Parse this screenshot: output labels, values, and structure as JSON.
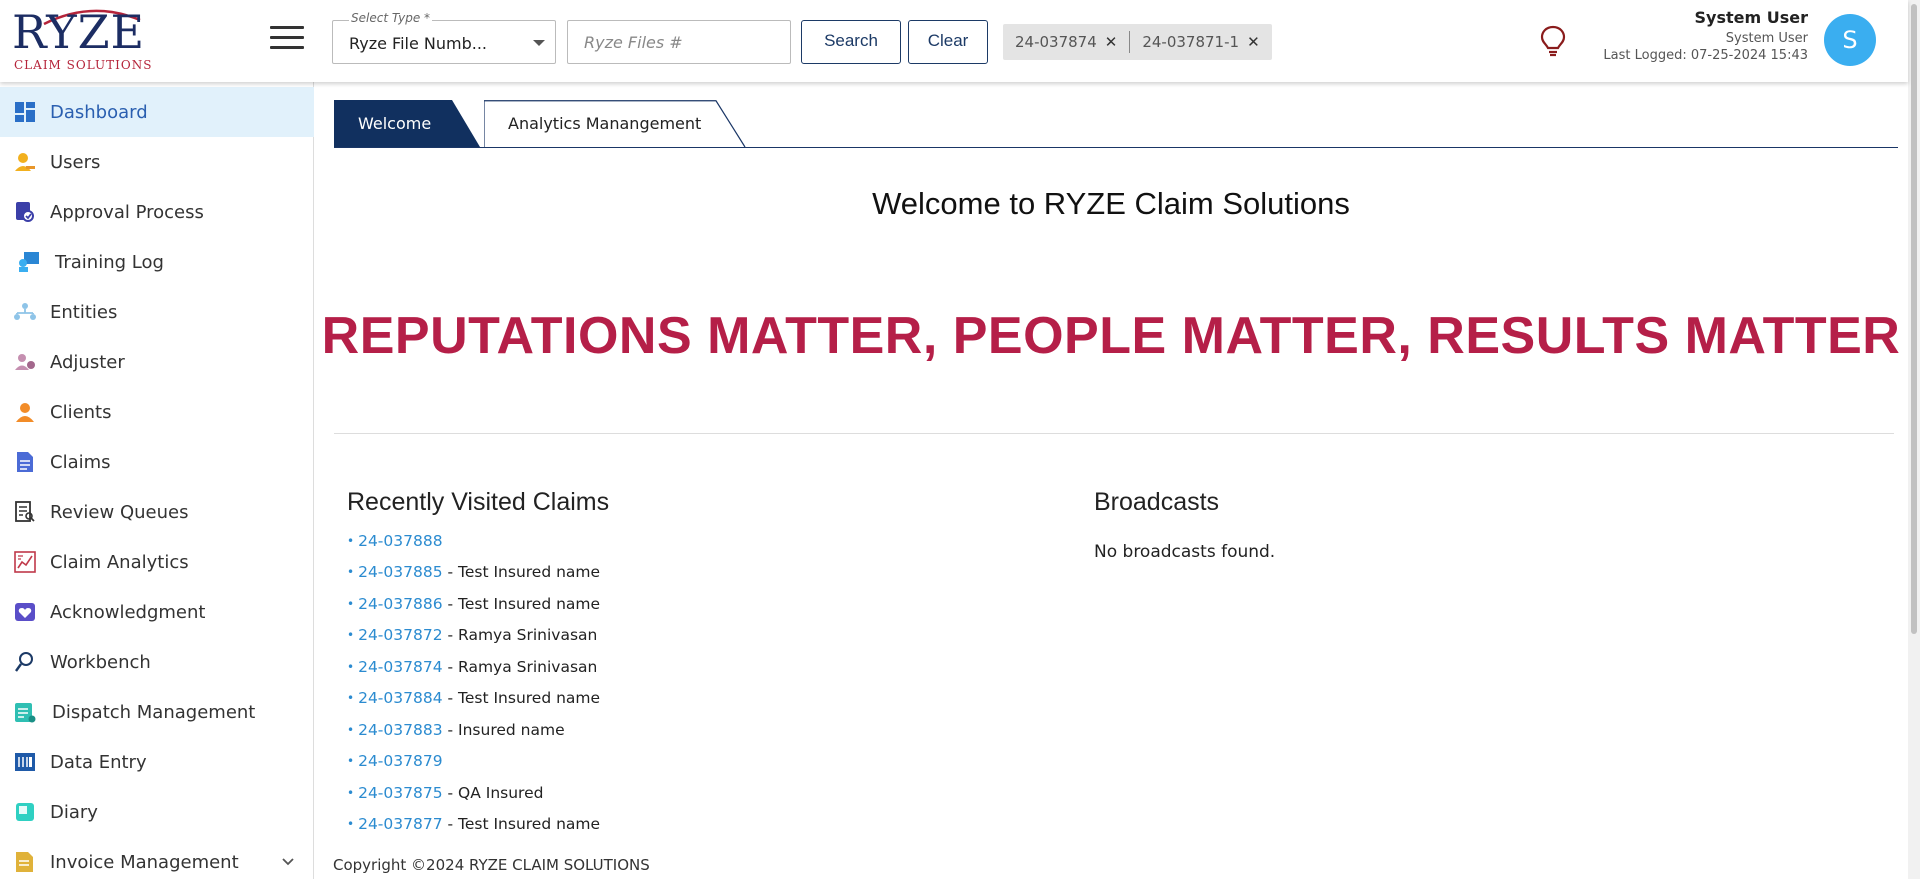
{
  "brand": {
    "logo_main": "RYZE",
    "logo_sub": "CLAIM SOLUTIONS"
  },
  "header": {
    "select_type": {
      "label": "Select Type *",
      "value": "Ryze File Numb..."
    },
    "files_input": {
      "placeholder": "Ryze Files #",
      "value": ""
    },
    "search_label": "Search",
    "clear_label": "Clear",
    "chips": [
      "24-037874",
      "24-037871-1"
    ],
    "user": {
      "name": "System User",
      "role": "System User",
      "last_logged": "Last Logged: 07-25-2024 15:43",
      "initial": "S"
    }
  },
  "sidebar": {
    "items": [
      {
        "label": "Dashboard",
        "icon": "dashboard-icon",
        "active": true
      },
      {
        "label": "Users",
        "icon": "users-icon"
      },
      {
        "label": "Approval Process",
        "icon": "approval-icon"
      },
      {
        "label": "Training Log",
        "icon": "training-icon"
      },
      {
        "label": "Entities",
        "icon": "entities-icon"
      },
      {
        "label": "Adjuster",
        "icon": "adjuster-icon"
      },
      {
        "label": "Clients",
        "icon": "clients-icon"
      },
      {
        "label": "Claims",
        "icon": "claims-icon"
      },
      {
        "label": "Review Queues",
        "icon": "review-icon"
      },
      {
        "label": "Claim Analytics",
        "icon": "analytics-icon"
      },
      {
        "label": "Acknowledgment",
        "icon": "acknowledgment-icon"
      },
      {
        "label": "Workbench",
        "icon": "workbench-icon"
      },
      {
        "label": "Dispatch Management",
        "icon": "dispatch-icon"
      },
      {
        "label": "Data Entry",
        "icon": "data-entry-icon"
      },
      {
        "label": "Diary",
        "icon": "diary-icon"
      },
      {
        "label": "Invoice Management",
        "icon": "invoice-icon"
      }
    ]
  },
  "tabs": [
    "Welcome",
    "Analytics Manangement"
  ],
  "main": {
    "welcome_title": "Welcome to RYZE Claim Solutions",
    "tagline": "REPUTATIONS MATTER, PEOPLE MATTER, RESULTS MATTER",
    "recent_title": "Recently Visited Claims",
    "recent_claims": [
      {
        "claim": "24-037888",
        "name": ""
      },
      {
        "claim": "24-037885",
        "name": "Test Insured name"
      },
      {
        "claim": "24-037886",
        "name": "Test Insured name"
      },
      {
        "claim": "24-037872",
        "name": "Ramya Srinivasan"
      },
      {
        "claim": "24-037874",
        "name": "Ramya Srinivasan"
      },
      {
        "claim": "24-037884",
        "name": "Test Insured name"
      },
      {
        "claim": "24-037883",
        "name": "Insured name"
      },
      {
        "claim": "24-037879",
        "name": ""
      },
      {
        "claim": "24-037875",
        "name": "QA Insured"
      },
      {
        "claim": "24-037877",
        "name": "Test Insured name"
      }
    ],
    "broadcasts_title": "Broadcasts",
    "broadcasts_empty": "No broadcasts found."
  },
  "footer": "Copyright ©2024 RYZE CLAIM SOLUTIONS",
  "colors": {
    "primary": "#11305f",
    "tagline": "#b51f48",
    "link": "#2b8bd0",
    "avatar": "#3aaef0",
    "active_bg": "#e1f1fb"
  }
}
